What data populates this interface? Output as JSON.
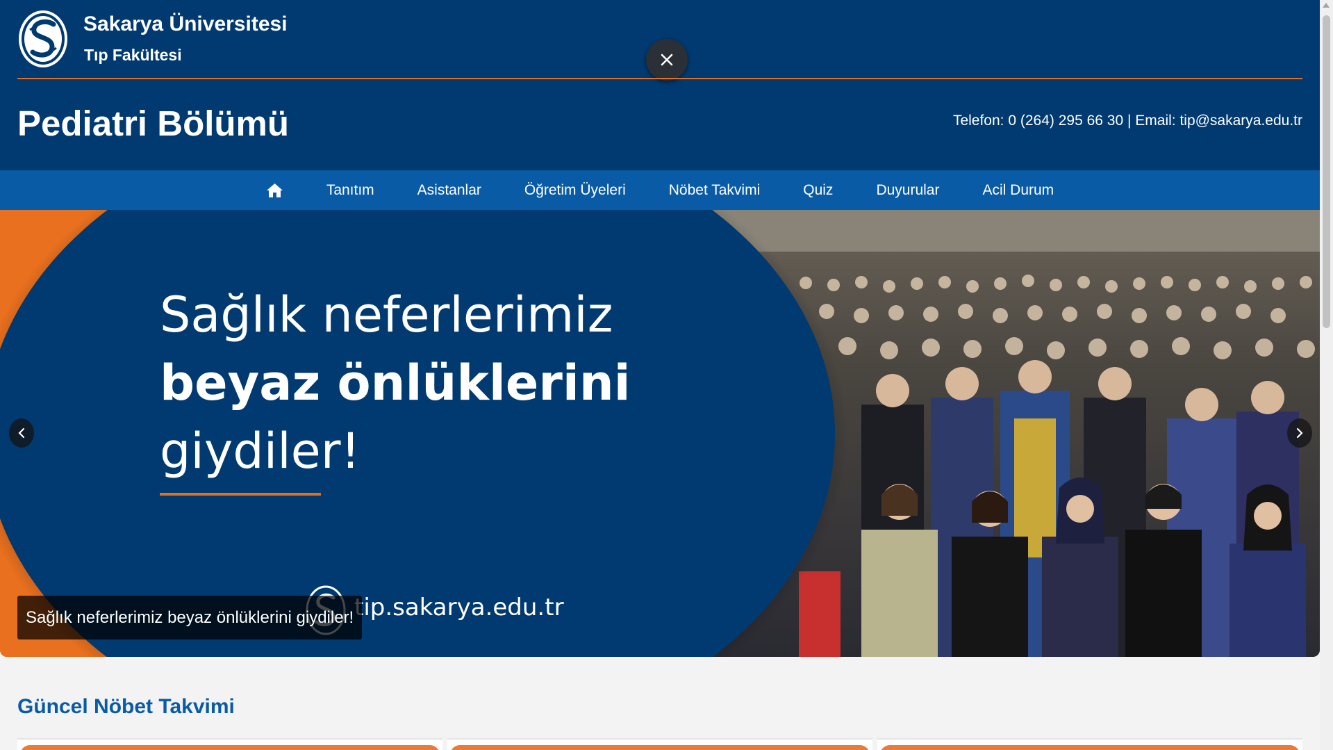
{
  "header": {
    "logo_icon": "sakarya-university-logo",
    "university_name": "Sakarya Üniversitesi",
    "faculty_name": "Tıp Fakültesi",
    "department_title": "Pediatri Bölümü",
    "contact": "Telefon: 0 (264) 295 66 30 | Email: tip@sakarya.edu.tr",
    "close_icon": "close-icon"
  },
  "nav": {
    "home_icon": "home-icon",
    "items": [
      {
        "label": "Tanıtım"
      },
      {
        "label": "Asistanlar"
      },
      {
        "label": "Öğretim Üyeleri"
      },
      {
        "label": "Nöbet Takvimi"
      },
      {
        "label": "Quiz"
      },
      {
        "label": "Duyurular"
      },
      {
        "label": "Acil Durum"
      }
    ]
  },
  "carousel": {
    "headline_line1": "Sağlık neferlerimiz",
    "headline_line2": "beyaz önlüklerini",
    "headline_line3": "giydiler!",
    "url": "tip.sakarya.edu.tr",
    "caption": "Sağlık neferlerimiz beyaz önlüklerini giydiler!",
    "prev_icon": "chevron-left-icon",
    "next_icon": "chevron-right-icon"
  },
  "content": {
    "section_title": "Güncel Nöbet Takvimi"
  },
  "colors": {
    "header_bg": "#003a70",
    "nav_bg": "#0a5ba6",
    "accent_orange": "#e46f1f",
    "section_title": "#0a5ba6"
  }
}
